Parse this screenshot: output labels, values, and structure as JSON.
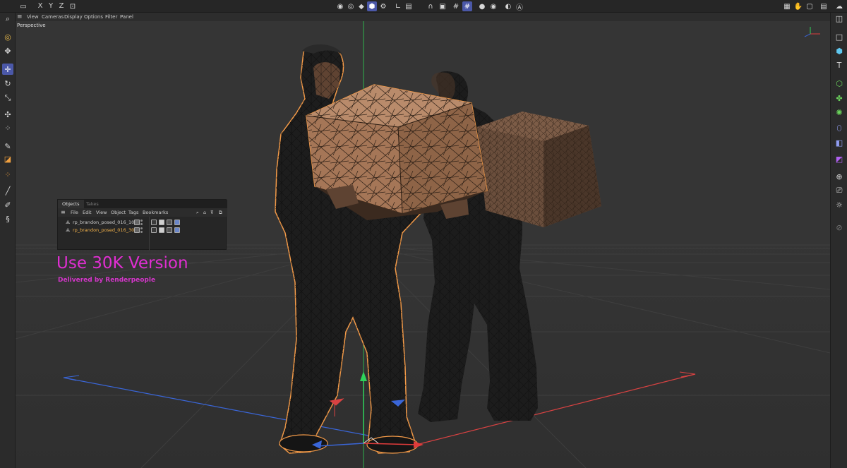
{
  "top_toolbar": {
    "axis_buttons": [
      "X",
      "Y",
      "Z"
    ],
    "icons": [
      "undo-icon",
      "axis-lock-icon",
      "coordinate-system-icon",
      "model-mode-icon",
      "mesh-mode-icon",
      "object-mode-icon",
      "points-mode-icon",
      "snap-icon",
      "grid-snap-icon",
      "workplane-icon",
      "render-view-icon",
      "render-settings-icon",
      "clapper-icon",
      "hand-icon",
      "layout-icon"
    ]
  },
  "viewport_menu": {
    "items": [
      "View",
      "Cameras",
      "Display",
      "Options",
      "Filter",
      "Panel"
    ],
    "projection": "Perspective"
  },
  "objects_panel": {
    "tabs": [
      "Objects",
      "Takes"
    ],
    "menu": [
      "File",
      "Edit",
      "View",
      "Object",
      "Tags",
      "Bookmarks"
    ],
    "rows": [
      {
        "name": "rp_brandon_posed_016_100k",
        "highlighted": false
      },
      {
        "name": "rp_brandon_posed_016_30k",
        "highlighted": true
      }
    ]
  },
  "overlay": {
    "title": "Use 30K Version",
    "subtitle": "Delivered by Renderpeople",
    "color": "#e02ed2"
  },
  "colors": {
    "accent": "#4b58a8",
    "selection_outline": "#f39a48",
    "axis_x": "#e03b3b",
    "axis_y": "#2ed35a",
    "axis_z": "#3a66d8"
  }
}
